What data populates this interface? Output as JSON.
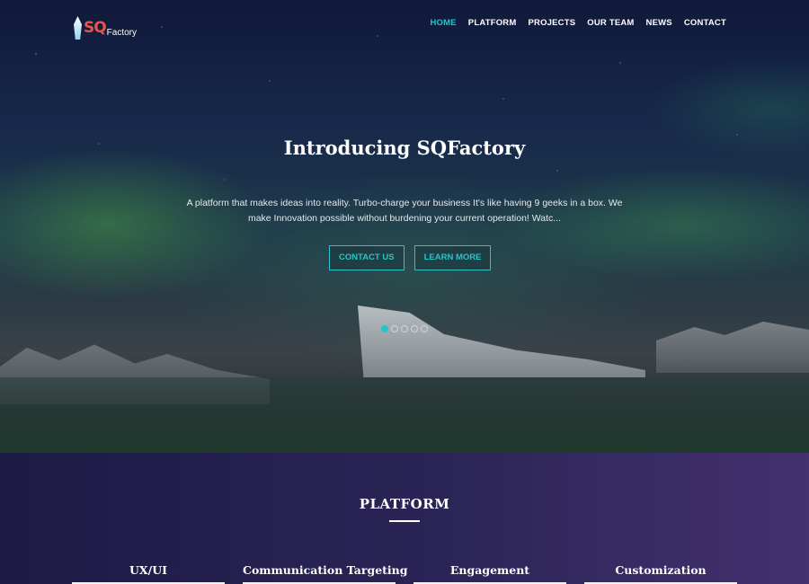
{
  "brand": {
    "logo_main": "SQ",
    "logo_sub": "Factory"
  },
  "nav": {
    "items": [
      {
        "label": "HOME",
        "active": true
      },
      {
        "label": "PLATFORM",
        "active": false
      },
      {
        "label": "PROJECTS",
        "active": false
      },
      {
        "label": "OUR TEAM",
        "active": false
      },
      {
        "label": "NEWS",
        "active": false
      },
      {
        "label": "CONTACT",
        "active": false
      }
    ]
  },
  "hero": {
    "title": "Introducing SQFactory",
    "text": "A platform that makes ideas into reality. Turbo-charge your business It's like having 9 geeks in a box. We make Innovation possible without burdening your current operation! Watc...",
    "buttons": {
      "contact": "CONTACT US",
      "learn": "LEARN MORE"
    },
    "slides": {
      "count": 5,
      "active_index": 0
    }
  },
  "platform": {
    "title": "PLATFORM",
    "features": [
      "UX/UI",
      "Communication Targeting",
      "Engagement",
      "Customization"
    ]
  },
  "colors": {
    "accent": "#27c4c9",
    "logo_red": "#e8534a",
    "section_bg": "#2b2557"
  },
  "icons": {
    "logo": "iceberg-icon"
  }
}
